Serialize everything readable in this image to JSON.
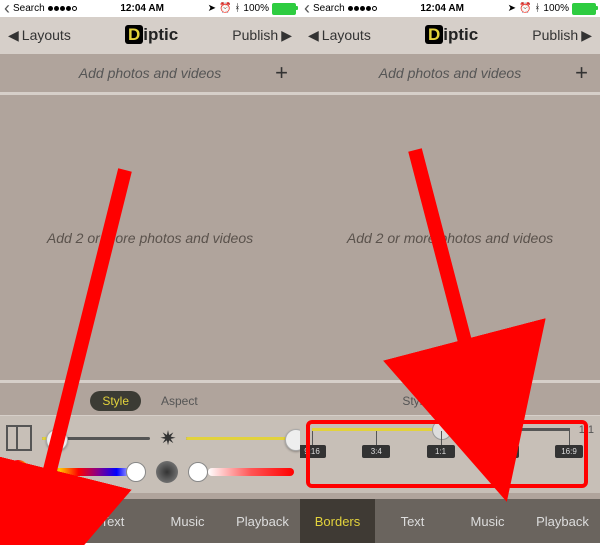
{
  "status": {
    "back_to": "Search",
    "time": "12:04 AM",
    "battery": "100%"
  },
  "nav": {
    "back": "Layouts",
    "app": "iptic",
    "forward": "Publish"
  },
  "addbar": {
    "text": "Add photos and videos"
  },
  "canvas": {
    "placeholder": "Add 2 or more photos and videos"
  },
  "pills": {
    "style": "Style",
    "aspect": "Aspect"
  },
  "aspect": {
    "label_1_1": "1:1",
    "ratios": [
      "9:16",
      "3:4",
      "1:1",
      "4:3",
      "16:9"
    ]
  },
  "tabs": {
    "borders": "Borders",
    "text": "Text",
    "music": "Music",
    "playback": "Playback"
  }
}
